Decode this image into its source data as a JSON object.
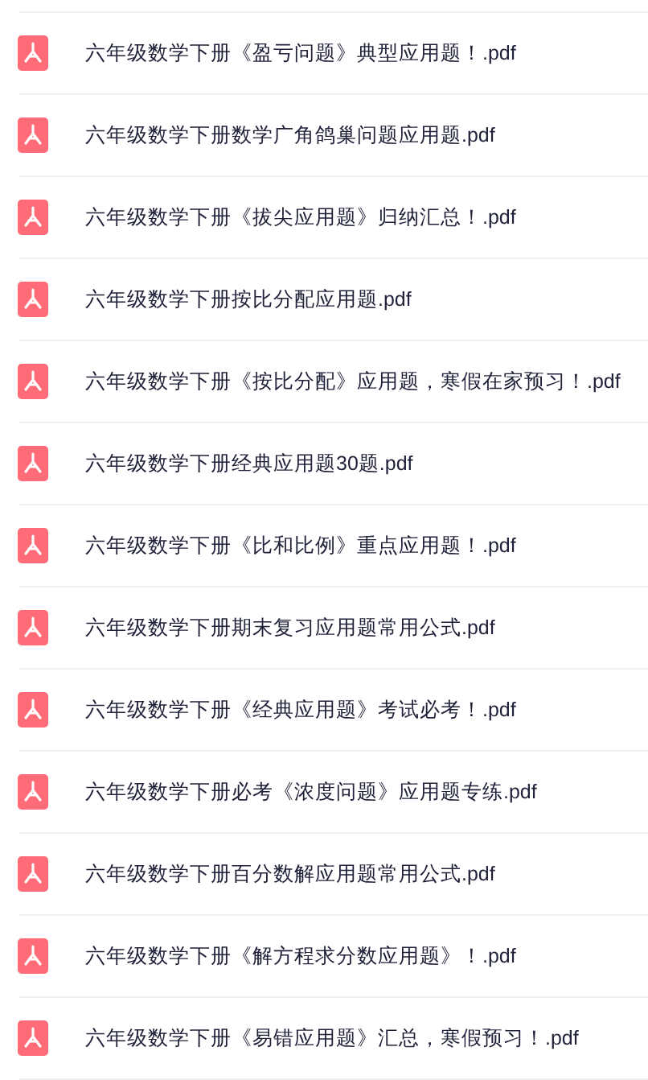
{
  "files": [
    {
      "name": "六年级数学下册《盈亏问题》典型应用题！.pdf"
    },
    {
      "name": "六年级数学下册数学广角鸽巢问题应用题.pdf"
    },
    {
      "name": "六年级数学下册《拔尖应用题》归纳汇总！.pdf"
    },
    {
      "name": "六年级数学下册按比分配应用题.pdf"
    },
    {
      "name": "六年级数学下册《按比分配》应用题，寒假在家预习！.pdf"
    },
    {
      "name": "六年级数学下册经典应用题30题.pdf"
    },
    {
      "name": "六年级数学下册《比和比例》重点应用题！.pdf"
    },
    {
      "name": "六年级数学下册期末复习应用题常用公式.pdf"
    },
    {
      "name": "六年级数学下册《经典应用题》考试必考！.pdf"
    },
    {
      "name": "六年级数学下册必考《浓度问题》应用题专练.pdf"
    },
    {
      "name": "六年级数学下册百分数解应用题常用公式.pdf"
    },
    {
      "name": "六年级数学下册《解方程求分数应用题》！.pdf"
    },
    {
      "name": "六年级数学下册《易错应用题》汇总，寒假预习！.pdf"
    }
  ]
}
